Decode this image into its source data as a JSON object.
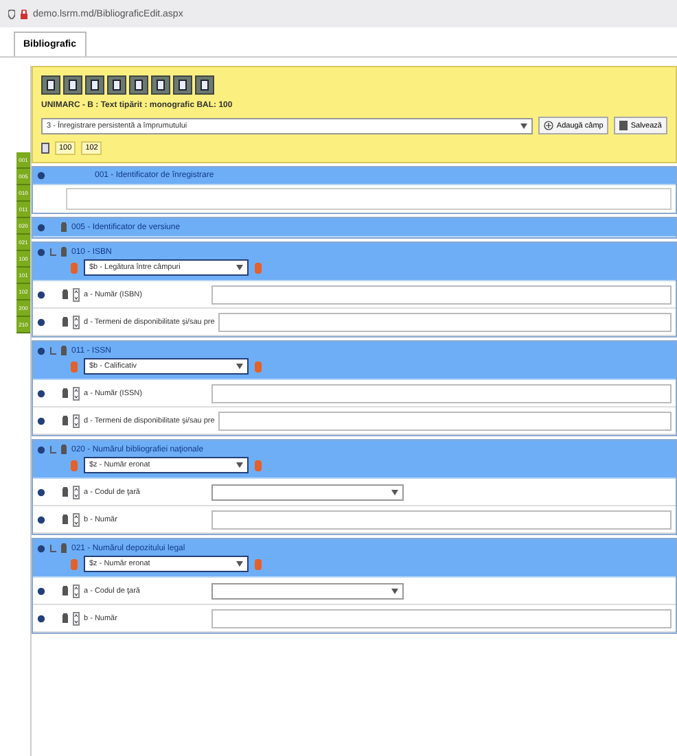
{
  "browser": {
    "url": "demo.lsrm.md/BibliograficEdit.aspx"
  },
  "tabs": [
    {
      "label": "Bibliografic",
      "selected": true
    }
  ],
  "header": {
    "format": "UNIMARC - B : Text tipărit : monografic   BAL: 100",
    "record_type": "3 - Înregistrare persistentă a împrumutului",
    "buttons": [
      "Adaugă câmp",
      "Salvează"
    ],
    "tags": [
      "100",
      "102"
    ]
  },
  "sidebar": {
    "items": [
      "001",
      "005",
      "010",
      "011",
      "020",
      "021",
      "100",
      "101",
      "102",
      "200",
      "210"
    ]
  },
  "fields": [
    {
      "kind": "control",
      "label": "001 - Identificator de înregistrare"
    },
    {
      "kind": "header",
      "label": "005 - Identificator de versiune"
    },
    {
      "kind": "data",
      "label": "010 - ISBN",
      "subfield_select": "$b - Legătura între câmpuri",
      "subfields": [
        {
          "kind": "input",
          "label": "a - Număr (ISBN)"
        },
        {
          "kind": "input",
          "label": "d - Termeni de disponibilitate şi/sau pre"
        }
      ]
    },
    {
      "kind": "data",
      "label": "011 - ISSN",
      "subfield_select": "$b - Calificativ",
      "subfields": [
        {
          "kind": "input",
          "label": "a - Număr (ISSN)"
        },
        {
          "kind": "input",
          "label": "d - Termeni de disponibilitate şi/sau pre"
        }
      ]
    },
    {
      "kind": "data",
      "label": "020 - Numărul bibliografiei naţionale",
      "subfield_select": "$z - Număr eronat",
      "subfields": [
        {
          "kind": "select",
          "label": "a - Codul de ţară"
        },
        {
          "kind": "input",
          "label": "b - Număr"
        }
      ]
    },
    {
      "kind": "data",
      "label": "021 - Numărul depozitului legal",
      "subfield_select": "$z - Număr eronat",
      "subfields": [
        {
          "kind": "select",
          "label": "a - Codul de ţară"
        },
        {
          "kind": "input",
          "label": "b - Număr"
        }
      ]
    }
  ]
}
